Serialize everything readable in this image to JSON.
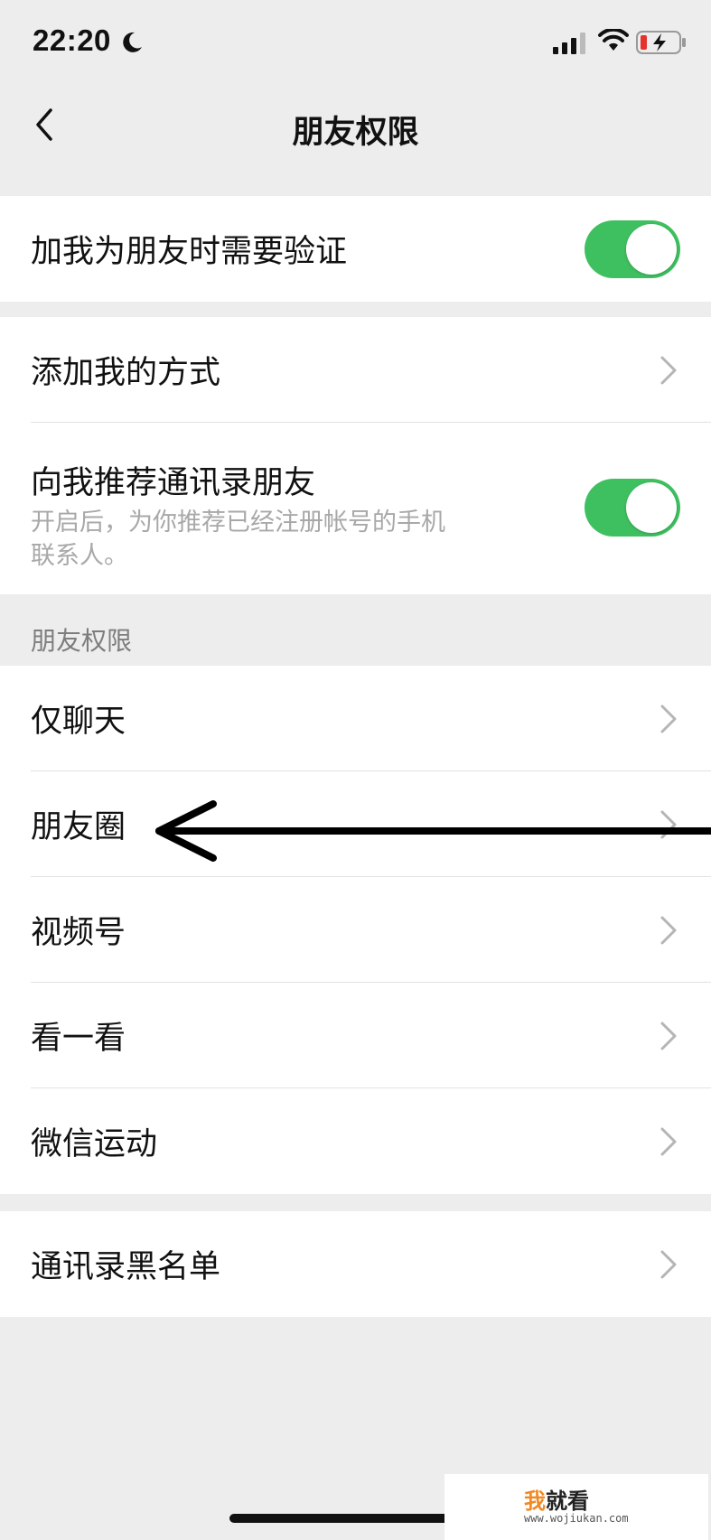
{
  "status_bar": {
    "time": "22:20"
  },
  "nav": {
    "title": "朋友权限"
  },
  "group1": {
    "verify_label": "加我为朋友时需要验证",
    "verify_on": true
  },
  "group2": {
    "add_method_label": "添加我的方式",
    "recommend_label": "向我推荐通讯录朋友",
    "recommend_desc": "开启后，为你推荐已经注册帐号的手机联系人。",
    "recommend_on": true
  },
  "section_header": "朋友权限",
  "friend_permissions": [
    {
      "label": "仅聊天"
    },
    {
      "label": "朋友圈"
    },
    {
      "label": "视频号"
    },
    {
      "label": "看一看"
    },
    {
      "label": "微信运动"
    }
  ],
  "group4": {
    "blacklist_label": "通讯录黑名单"
  },
  "watermark": {
    "logo_first": "我",
    "logo_rest": "就看",
    "url": "www.wojiukan.com"
  },
  "colors": {
    "toggle_on": "#3fc060",
    "background": "#ededed"
  }
}
